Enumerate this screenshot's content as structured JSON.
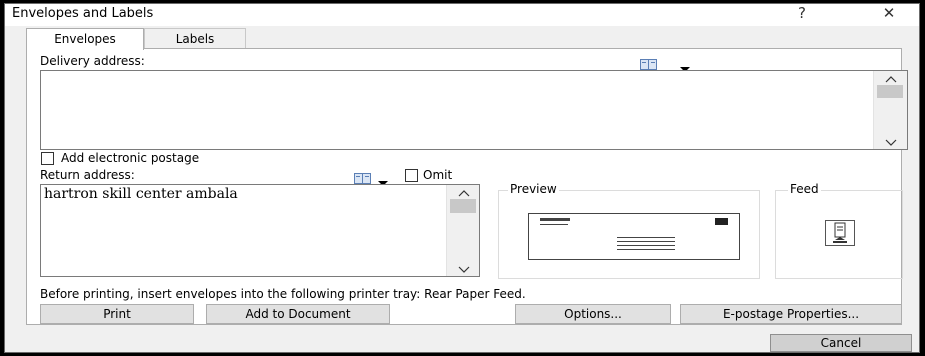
{
  "window": {
    "title": "Envelopes and Labels",
    "help_glyph": "?",
    "close_glyph": "✕"
  },
  "tabs": [
    {
      "label": "Envelopes",
      "active": true
    },
    {
      "label": "Labels",
      "active": false
    }
  ],
  "delivery": {
    "label": "Delivery address:",
    "value": ""
  },
  "electronic_postage": {
    "label": "Add electronic postage",
    "checked": false
  },
  "return_address": {
    "label": "Return address:",
    "value": "hartron skill center ambala",
    "omit_label": "Omit",
    "omit_checked": false
  },
  "icons": {
    "address_book": "address-book-icon",
    "dropdown": "dropdown-arrow-icon",
    "scroll_up": "scroll-up-icon",
    "scroll_down": "scroll-down-icon",
    "feed": "feed-icon"
  },
  "preview": {
    "label": "Preview"
  },
  "feed": {
    "label": "Feed"
  },
  "printer_note": "Before printing, insert envelopes into the following printer tray: Rear Paper Feed.",
  "buttons": {
    "print": "Print",
    "add_to_document": "Add to Document",
    "options": "Options...",
    "epostage": "E-postage Properties...",
    "cancel": "Cancel"
  },
  "colors": {
    "window_bg": "#f0f0f0",
    "panel_bg": "#ffffff",
    "button_bg": "#e1e1e1",
    "cancel_default": "#cfcfcf"
  }
}
